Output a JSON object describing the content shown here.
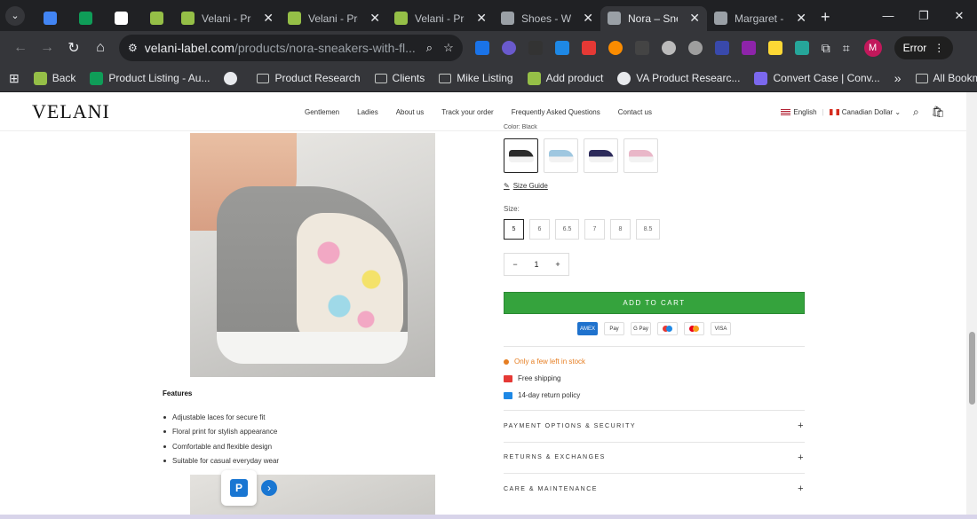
{
  "browser": {
    "tabs": [
      {
        "title": "",
        "icon": "docs-icon",
        "color": "#4285f4"
      },
      {
        "title": "",
        "icon": "sheets-icon",
        "color": "#0f9d58"
      },
      {
        "title": "",
        "icon": "google-icon",
        "color": "#ffffff"
      },
      {
        "title": "",
        "icon": "shopify-icon",
        "color": "#95bf47"
      },
      {
        "title": "Velani - Prod",
        "icon": "shopify-icon",
        "color": "#95bf47"
      },
      {
        "title": "Velani - Prod",
        "icon": "shopify-icon",
        "color": "#95bf47"
      },
      {
        "title": "Velani - Prod",
        "icon": "shopify-icon",
        "color": "#95bf47"
      },
      {
        "title": "Shoes - Won",
        "icon": "globe-icon",
        "color": "#9aa0a6"
      },
      {
        "title": "Nora – Sneal",
        "icon": "globe-icon",
        "color": "#9aa0a6",
        "active": true
      },
      {
        "title": "Margaret - N",
        "icon": "globe-icon",
        "color": "#9aa0a6"
      }
    ],
    "url_domain": "velani-label.com",
    "url_path": "/products/nora-sneakers-with-fl...",
    "profile_initial": "M",
    "error_label": "Error",
    "bookmarks": [
      {
        "label": "",
        "icon": "apps-icon"
      },
      {
        "label": "Back",
        "icon": "shopify-icon",
        "color": "#95bf47"
      },
      {
        "label": "Product Listing - Au...",
        "icon": "sheets-icon",
        "color": "#0f9d58"
      },
      {
        "label": "",
        "icon": "globe-icon",
        "color": "#e8eaed"
      },
      {
        "label": "Product Research",
        "icon": "folder-icon"
      },
      {
        "label": "Clients",
        "icon": "folder-icon"
      },
      {
        "label": "Mike Listing",
        "icon": "folder-icon"
      },
      {
        "label": "Add product",
        "icon": "shopify-icon",
        "color": "#95bf47"
      },
      {
        "label": "VA Product Researc...",
        "icon": "globe-icon",
        "color": "#e8eaed"
      },
      {
        "label": "Convert Case | Conv...",
        "icon": "convert-icon",
        "color": "#7b68ee"
      }
    ],
    "all_bookmarks": "All Bookmarks"
  },
  "site": {
    "logo": "VELANI",
    "nav": [
      "Gentlemen",
      "Ladies",
      "About us",
      "Track your order",
      "Frequently Asked Questions",
      "Contact us"
    ],
    "language": "English",
    "currency": "Canadian Dollar"
  },
  "product": {
    "color_label": "Color: Black",
    "swatch_colors": [
      "#2b2b2b",
      "#9fc7e0",
      "#2c2a5a",
      "#e9b7c8"
    ],
    "size_guide": "Size Guide",
    "size_label": "Size:",
    "sizes": [
      "5",
      "6",
      "6.5",
      "7",
      "8",
      "8.5"
    ],
    "quantity": "1",
    "add_to_cart": "ADD TO CART",
    "payments": [
      {
        "name": "amex-icon",
        "label": "AMEX"
      },
      {
        "name": "apple-pay-icon",
        "label": "Pay"
      },
      {
        "name": "google-pay-icon",
        "label": "G Pay"
      },
      {
        "name": "maestro-icon",
        "label": ""
      },
      {
        "name": "mastercard-icon",
        "label": ""
      },
      {
        "name": "visa-icon",
        "label": "VISA"
      }
    ],
    "stock": "Only a few left in stock",
    "shipping": "Free shipping",
    "returns": "14-day return policy",
    "accordions": [
      "PAYMENT OPTIONS & SECURITY",
      "RETURNS & EXCHANGES",
      "CARE & MAINTENANCE"
    ]
  },
  "features": {
    "title": "Features",
    "items": [
      "Adjustable laces for secure fit",
      "Floral print for stylish appearance",
      "Comfortable and flexible design",
      "Suitable for casual everyday wear"
    ]
  }
}
